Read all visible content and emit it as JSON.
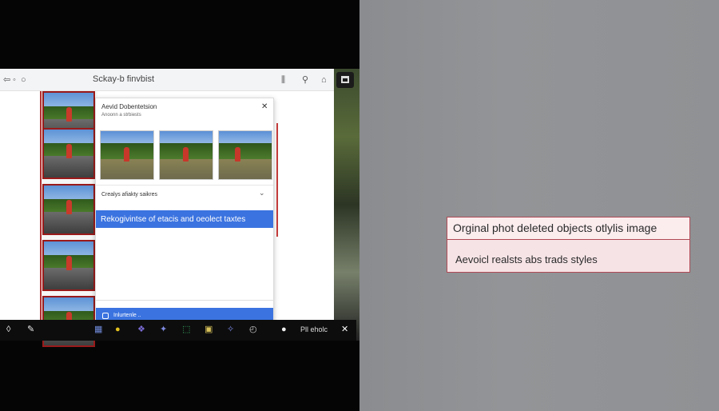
{
  "window": {
    "title": "Sckay-b finvbist",
    "titlebar_left_icons": [
      "back-arrow-icon",
      "dot-icon",
      "circle-icon"
    ],
    "titlebar_right_icons": [
      "bars-icon",
      "search-icon",
      "share-icon"
    ]
  },
  "dialog": {
    "title": "Aevid Dobentetsion",
    "subtitle": "Anoonn a strbiests",
    "close_symbol": "✕",
    "thumbnails": [
      "thumbnail-1",
      "thumbnail-2",
      "thumbnail-3"
    ],
    "dropdown_label": "Crealys afiakty saikres",
    "dropdown_chevron": "⌄",
    "selected_option": "Rekogivintse of etacis and oeolect taxtes",
    "confirm_label": "Inlurtenle .."
  },
  "toolbar": {
    "label": "Pll  eholc",
    "close_symbol": "✕",
    "tools": [
      {
        "icon": "drop-icon",
        "glyph": "◊",
        "color": "#e8e8e8"
      },
      {
        "icon": "brush-icon",
        "glyph": "✎",
        "color": "#e8e8e8"
      },
      {
        "icon": "grid-icon",
        "glyph": "▦",
        "color": "#6f8ad8"
      },
      {
        "icon": "emoji-icon",
        "glyph": "●",
        "color": "#e3c21e"
      },
      {
        "icon": "split-icon",
        "glyph": "❖",
        "color": "#7b6cd6"
      },
      {
        "icon": "sparkle-icon",
        "glyph": "✦",
        "color": "#7e8ae0"
      },
      {
        "icon": "crop-icon",
        "glyph": "⬚",
        "color": "#39b56a"
      },
      {
        "icon": "image-icon",
        "glyph": "▣",
        "color": "#d8c25a"
      },
      {
        "icon": "magic-icon",
        "glyph": "✧",
        "color": "#7c88e3"
      },
      {
        "icon": "timer-icon",
        "glyph": "◴",
        "color": "#d0d0d0"
      },
      {
        "icon": "toggle-icon",
        "glyph": "●",
        "color": "#f0f0f0"
      }
    ]
  },
  "info_card": {
    "line1": "Orginal phot deleted objects otlylis image",
    "line2": "Aevoicl realsts abs trads styles"
  }
}
